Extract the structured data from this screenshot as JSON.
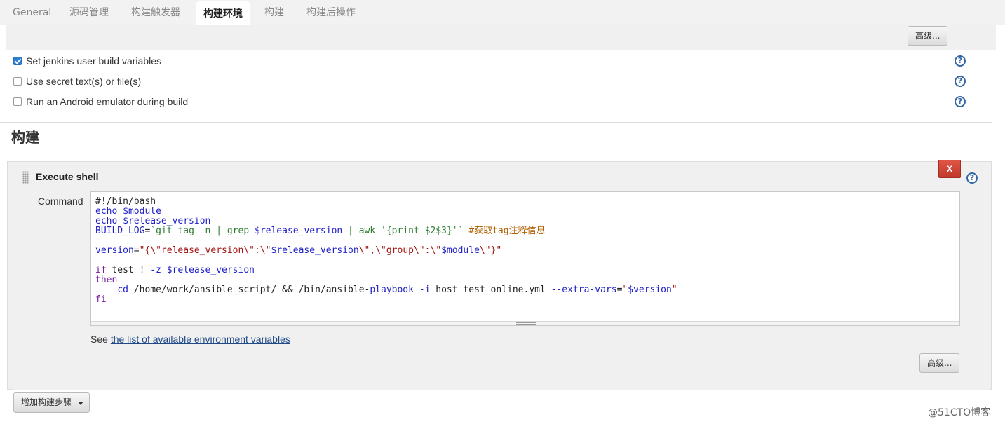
{
  "tabs": [
    {
      "label": "General",
      "active": false
    },
    {
      "label": "源码管理",
      "active": false
    },
    {
      "label": "构建触发器",
      "active": false
    },
    {
      "label": "构建环境",
      "active": true
    },
    {
      "label": "构建",
      "active": false
    },
    {
      "label": "构建后操作",
      "active": false
    }
  ],
  "build_env": {
    "advanced_label": "高级...",
    "options": [
      {
        "label": "Set jenkins user build variables",
        "checked": true
      },
      {
        "label": "Use secret text(s) or file(s)",
        "checked": false
      },
      {
        "label": "Run an Android emulator during build",
        "checked": false
      }
    ],
    "help_glyph": "?"
  },
  "build": {
    "section_title": "构建",
    "step_title": "Execute shell",
    "delete_label": "X",
    "command_label": "Command",
    "command_lines": [
      "#!/bin/bash",
      "echo $module",
      "echo $release_version",
      "BUILD_LOG=`git tag -n | grep $release_version | awk '{print $2$3}'` #获取tag注释信息",
      "",
      "version=\"{\\\"release_version\\\":\\\"$release_version\\\",\\\"group\\\":\\\"$module\\\"}\"",
      "",
      "if test ! -z $release_version",
      "then",
      "    cd /home/work/ansible_script/ && /bin/ansible-playbook -i host test_online.yml --extra-vars=\"$version\"",
      "fi"
    ],
    "see_prefix": "See",
    "env_link": "the list of available environment variables",
    "advanced_label": "高级...",
    "add_step_label": "增加构建步骤"
  },
  "watermark": "@51CTO博客",
  "colors": {
    "delete_button": "#c9432f",
    "checkbox_on": "#2d7fd3",
    "help_icon": "#3465a4",
    "link": "#204a87"
  }
}
